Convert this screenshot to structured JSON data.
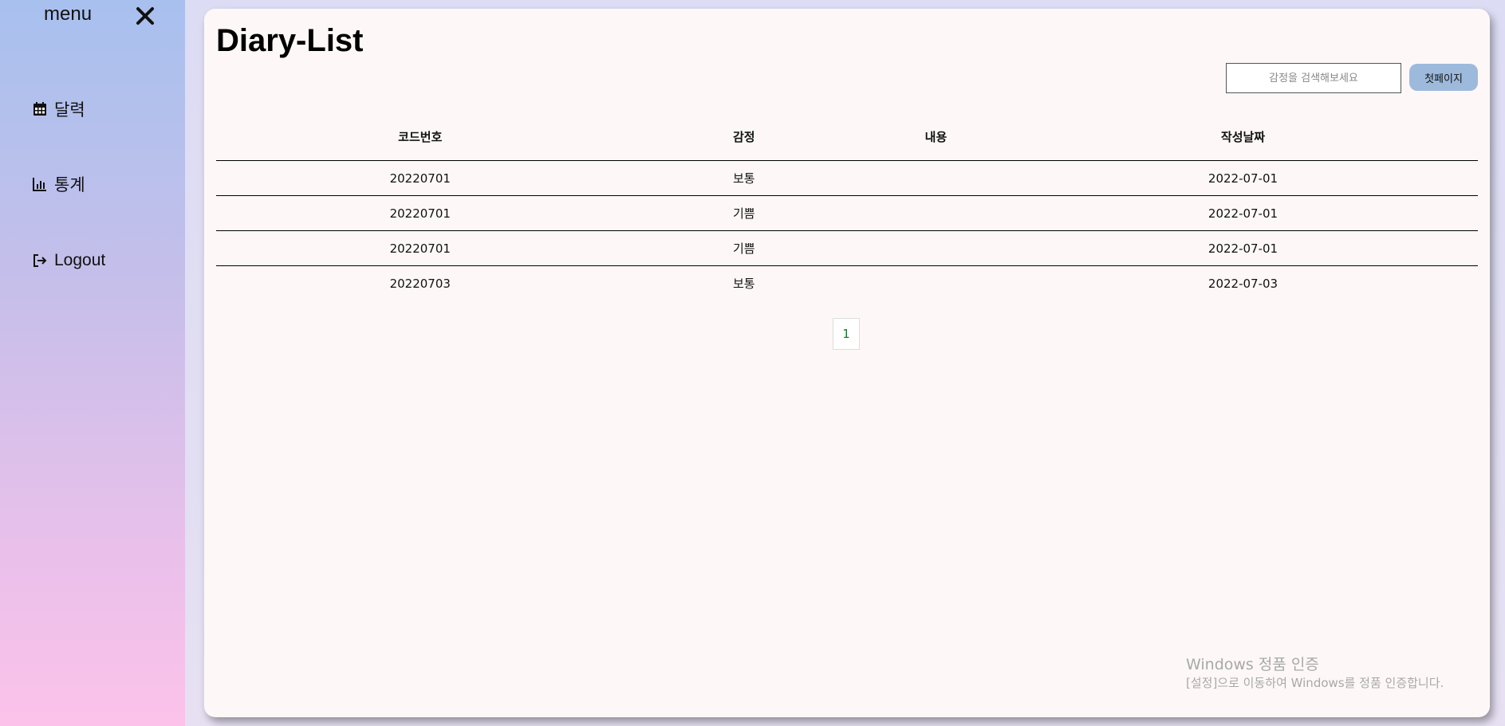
{
  "sidebar": {
    "menu_title": "menu",
    "close_icon": "close-icon",
    "items": [
      {
        "label": "달력",
        "icon": "calendar-icon"
      },
      {
        "label": "통계",
        "icon": "chart-icon"
      },
      {
        "label": "Logout",
        "icon": "logout-icon"
      }
    ]
  },
  "main": {
    "title": "Diary-List",
    "search": {
      "placeholder": "감정을 검색해보세요",
      "value": ""
    },
    "first_page_button": "첫페이지",
    "table": {
      "headers": [
        "코드번호",
        "감정",
        "내용",
        "작성날짜"
      ],
      "rows": [
        {
          "code": "20220701",
          "emotion": "보통",
          "content": "",
          "date": "2022-07-01"
        },
        {
          "code": "20220701",
          "emotion": "기쁨",
          "content": "",
          "date": "2022-07-01"
        },
        {
          "code": "20220701",
          "emotion": "기쁨",
          "content": "",
          "date": "2022-07-01"
        },
        {
          "code": "20220703",
          "emotion": "보통",
          "content": "",
          "date": "2022-07-03"
        }
      ]
    },
    "pagination": {
      "current": "1"
    }
  },
  "watermark": {
    "title": "Windows 정품 인증",
    "subtitle": "[설정]으로 이동하여 Windows를 정품 인증합니다."
  },
  "colors": {
    "sidebar_top": "#a8c0ee",
    "sidebar_bottom": "#fcc2ea",
    "card_bg": "#fdf8f7",
    "button_bg": "#9dbadc",
    "page_link": "#1a7a2e"
  }
}
